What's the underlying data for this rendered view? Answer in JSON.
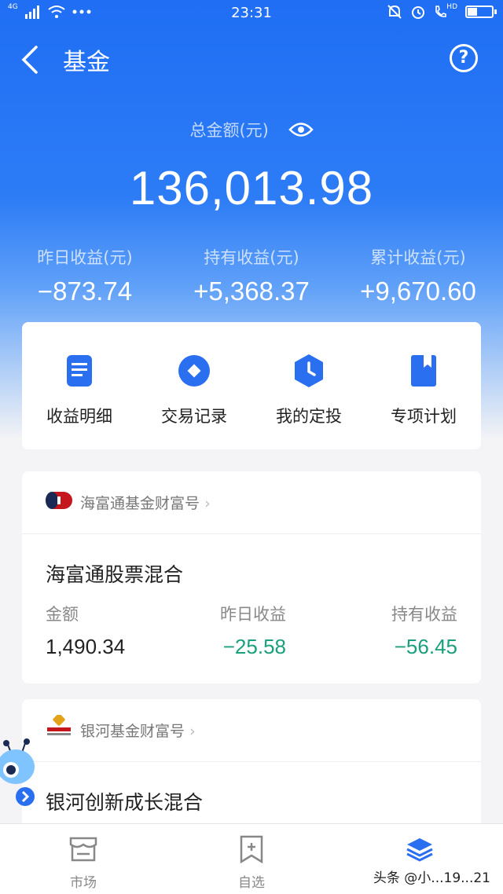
{
  "status_bar": {
    "network": "4G",
    "time": "23:31",
    "hd_badge": "HD"
  },
  "header": {
    "title": "基金"
  },
  "summary": {
    "total_label": "总金额(元)",
    "total_amount": "136,013.98",
    "stats": [
      {
        "label": "昨日收益(元)",
        "value": "−873.74"
      },
      {
        "label": "持有收益(元)",
        "value": "+5,368.37"
      },
      {
        "label": "累计收益(元)",
        "value": "+9,670.60"
      }
    ]
  },
  "quick_actions": [
    {
      "label": "收益明细",
      "icon": "document-icon"
    },
    {
      "label": "交易记录",
      "icon": "record-icon"
    },
    {
      "label": "我的定投",
      "icon": "clock-icon"
    },
    {
      "label": "专项计划",
      "icon": "bookmark-icon"
    }
  ],
  "funds": [
    {
      "brand": "海富通基金财富号",
      "name": "海富通股票混合",
      "amount_label": "金额",
      "amount": "1,490.34",
      "yesterday_label": "昨日收益",
      "yesterday": "−25.58",
      "holding_label": "持有收益",
      "holding": "−56.45"
    },
    {
      "brand": "银河基金财富号",
      "name": "银河创新成长混合"
    }
  ],
  "tabbar": [
    {
      "label": "市场",
      "icon": "market-icon"
    },
    {
      "label": "自选",
      "icon": "watchlist-icon"
    },
    {
      "label": "",
      "icon": "holdings-icon"
    }
  ],
  "watermark": "头条 @小...19...21",
  "colors": {
    "primary": "#1f6ef4",
    "negative": "#1aa07c"
  }
}
